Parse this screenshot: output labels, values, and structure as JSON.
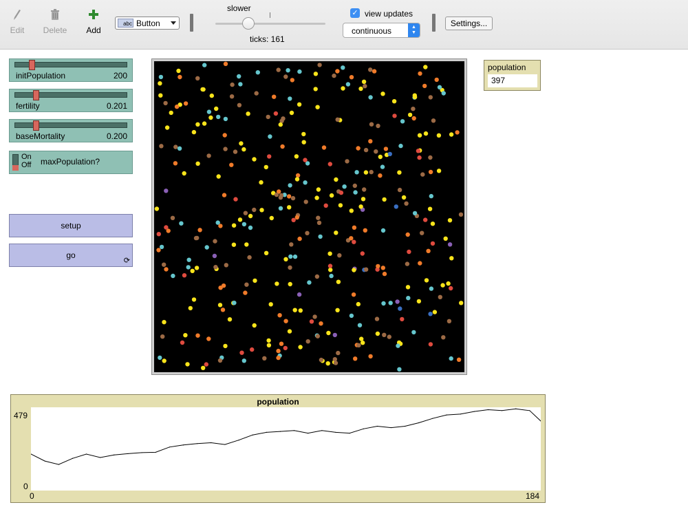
{
  "toolbar": {
    "edit_label": "Edit",
    "delete_label": "Delete",
    "add_label": "Add",
    "widget_type": "Button",
    "widget_badge": "abc",
    "speed_label": "slower",
    "ticks_label": "ticks: 161",
    "view_updates_label": "view updates",
    "view_updates_checked": true,
    "update_mode": "continuous",
    "settings_label": "Settings..."
  },
  "sliders": [
    {
      "name": "initPopulation",
      "value": "200",
      "level": 0.15
    },
    {
      "name": "fertility",
      "value": "0.201",
      "level": 0.2
    },
    {
      "name": "baseMortality",
      "value": "0.200",
      "level": 0.2
    }
  ],
  "switch": {
    "on_label": "On",
    "off_label": "Off",
    "name": "maxPopulation?",
    "state": "off"
  },
  "buttons": {
    "setup_label": "setup",
    "go_label": "go"
  },
  "monitor": {
    "name": "population",
    "value": "397"
  },
  "world": {
    "background": "#000000",
    "agent_colors": [
      "#f9e41b",
      "#f07b2a",
      "#df4b3f",
      "#9c6a45",
      "#65c6cd",
      "#8a60b6",
      "#3a6fc2"
    ],
    "agent_count": 397
  },
  "plot": {
    "title": "population",
    "y_max_label": "479",
    "y_min_label": "0",
    "x_min_label": "0",
    "x_max_label": "184"
  },
  "chart_data": {
    "type": "line",
    "title": "population",
    "xlim": [
      0,
      184
    ],
    "ylim": [
      0,
      479
    ],
    "series": [
      {
        "x": [
          0,
          5,
          10,
          15,
          20,
          25,
          30,
          35,
          40,
          45,
          50,
          55,
          60,
          65,
          70,
          75,
          80,
          85,
          90,
          95,
          100,
          105,
          110,
          115,
          120,
          125,
          130,
          135,
          140,
          145,
          150,
          155,
          160,
          165,
          170,
          175,
          180,
          184
        ],
        "values": [
          210,
          170,
          150,
          185,
          210,
          190,
          205,
          212,
          218,
          220,
          250,
          262,
          270,
          275,
          265,
          290,
          320,
          335,
          340,
          345,
          330,
          345,
          335,
          330,
          355,
          370,
          362,
          370,
          390,
          415,
          435,
          440,
          455,
          465,
          460,
          470,
          460,
          400
        ]
      }
    ]
  }
}
